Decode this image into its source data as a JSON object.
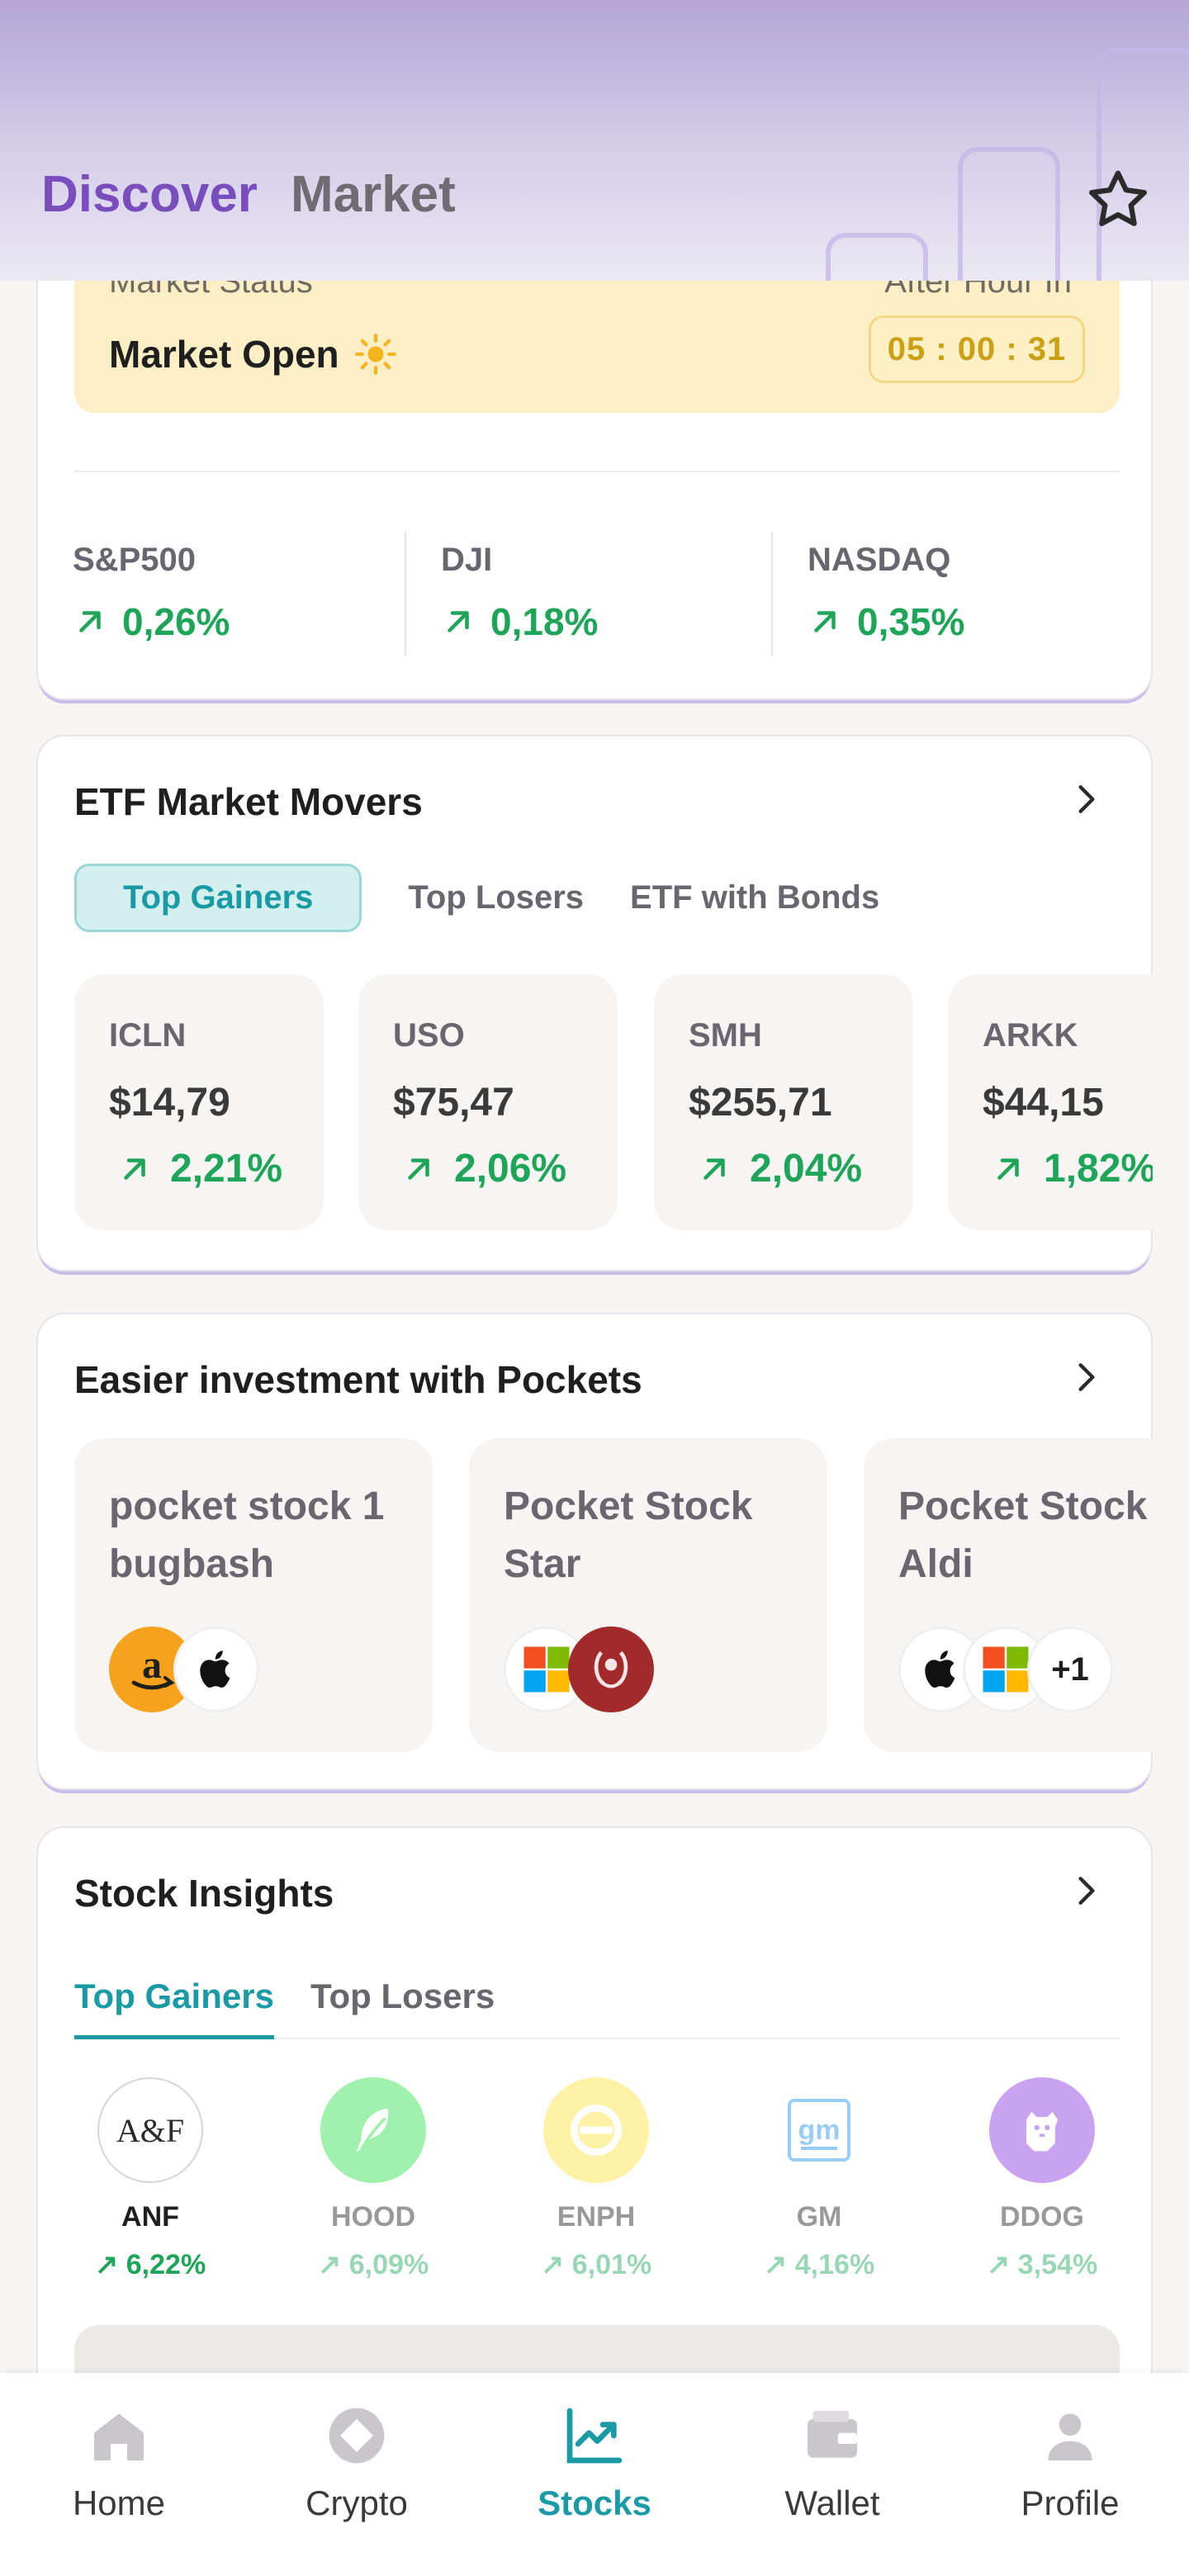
{
  "header": {
    "tabs": [
      "Discover",
      "Market"
    ]
  },
  "market": {
    "status_label": "Market Status",
    "status_value": "Market Open",
    "after_label": "After Hour In",
    "countdown": "05 : 00 : 31",
    "indices": [
      {
        "name": "S&P500",
        "change": "0,26%"
      },
      {
        "name": "DJI",
        "change": "0,18%"
      },
      {
        "name": "NASDAQ",
        "change": "0,35%"
      }
    ]
  },
  "etf": {
    "title": "ETF Market Movers",
    "tabs": [
      "Top Gainers",
      "Top Losers",
      "ETF with Bonds"
    ],
    "tiles": [
      {
        "symbol": "ICLN",
        "price": "$14,79",
        "change": "2,21%"
      },
      {
        "symbol": "USO",
        "price": "$75,47",
        "change": "2,06%"
      },
      {
        "symbol": "SMH",
        "price": "$255,71",
        "change": "2,04%"
      },
      {
        "symbol": "ARKK",
        "price": "$44,15",
        "change": "1,82%"
      }
    ]
  },
  "pockets": {
    "title": "Easier investment with Pockets",
    "items": [
      {
        "name": "pocket stock 1\nbugbash"
      },
      {
        "name": "Pocket Stock\nStar"
      },
      {
        "name": "Pocket Stock\nAldi",
        "more": "+1"
      }
    ]
  },
  "insights": {
    "title": "Stock Insights",
    "tabs": [
      "Top Gainers",
      "Top Losers"
    ],
    "items": [
      {
        "symbol": "ANF",
        "change": "6,22%",
        "logo_text": "A&F"
      },
      {
        "symbol": "HOOD",
        "change": "6,09%"
      },
      {
        "symbol": "ENPH",
        "change": "6,01%"
      },
      {
        "symbol": "GM",
        "change": "4,16%",
        "logo_text": "gm"
      },
      {
        "symbol": "DDOG",
        "change": "3,54%"
      }
    ]
  },
  "nav": {
    "items": [
      {
        "label": "Home",
        "icon": "home-icon"
      },
      {
        "label": "Crypto",
        "icon": "crypto-icon"
      },
      {
        "label": "Stocks",
        "icon": "stocks-icon"
      },
      {
        "label": "Wallet",
        "icon": "wallet-icon"
      },
      {
        "label": "Profile",
        "icon": "profile-icon"
      }
    ],
    "active": "Stocks"
  },
  "colors": {
    "accent": "#1a9aa5",
    "positive": "#1fa55a",
    "brand_purple": "#7a4dbd",
    "warning_bg": "#fcefc6"
  }
}
